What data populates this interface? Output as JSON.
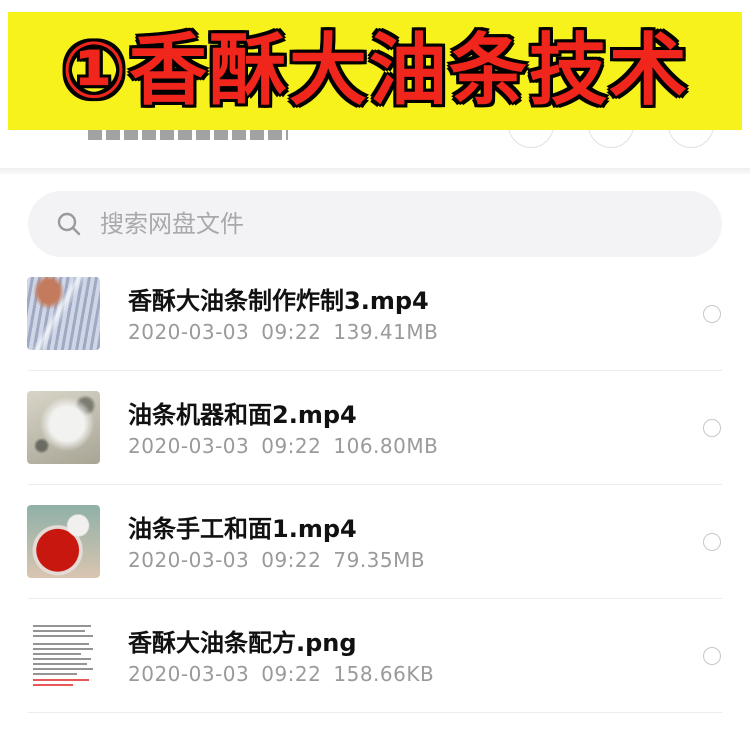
{
  "banner": {
    "title": "①香酥大油条技术"
  },
  "search": {
    "placeholder": "搜索网盘文件"
  },
  "files": [
    {
      "name": "香酥大油条制作炸制3.mp4",
      "date": "2020-03-03",
      "time": "09:22",
      "size": "139.41MB",
      "thumb_icon": "video-thumbnail-frying"
    },
    {
      "name": "油条机器和面2.mp4",
      "date": "2020-03-03",
      "time": "09:22",
      "size": "106.80MB",
      "thumb_icon": "video-thumbnail-dough-machine"
    },
    {
      "name": "油条手工和面1.mp4",
      "date": "2020-03-03",
      "time": "09:22",
      "size": "79.35MB",
      "thumb_icon": "video-thumbnail-hand-mixing"
    },
    {
      "name": "香酥大油条配方.png",
      "date": "2020-03-03",
      "time": "09:22",
      "size": "158.66KB",
      "thumb_icon": "image-thumbnail-recipe-document"
    }
  ],
  "colors": {
    "banner_background": "#f7f21c",
    "banner_text": "#f0251c",
    "meta_text": "#9a9a9a",
    "search_background": "#f3f3f5"
  }
}
